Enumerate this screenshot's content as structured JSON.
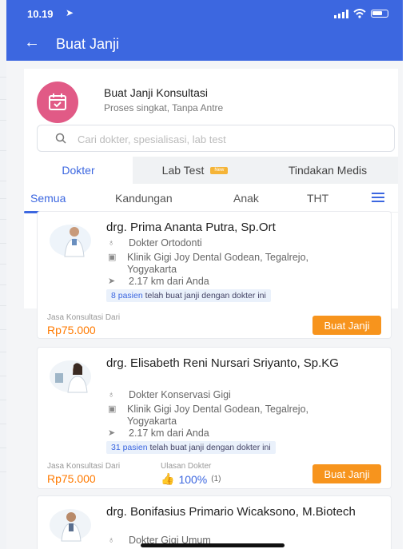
{
  "status_bar": {
    "time": "10.19"
  },
  "header": {
    "title": "Buat Janji"
  },
  "intro": {
    "title": "Buat Janji Konsultasi",
    "subtitle": "Proses singkat, Tanpa Antre"
  },
  "search": {
    "placeholder": "Cari dokter, spesialisasi, lab test"
  },
  "main_tabs": [
    {
      "label": "Dokter",
      "active": true
    },
    {
      "label": "Lab Test",
      "badge": "New"
    },
    {
      "label": "Tindakan Medis"
    }
  ],
  "sub_tabs": [
    {
      "label": "Semua",
      "active": true
    },
    {
      "label": "Kandungan"
    },
    {
      "label": "Anak"
    },
    {
      "label": "THT"
    }
  ],
  "doctors": [
    {
      "name": "drg. Prima Ananta Putra, Sp.Ort",
      "specialty": "Dokter Ortodonti",
      "clinic": "Klinik Gigi Joy Dental Godean, Tegalrejo, Yogyakarta",
      "distance": "2.17 km dari Anda",
      "patients_count": "8 pasien",
      "patients_text": "telah buat janji dengan dokter ini",
      "price_label": "Jasa Konsultasi Dari",
      "price": "Rp75.000",
      "button": "Buat Janji"
    },
    {
      "name": "drg. Elisabeth Reni Nursari Sriyanto, Sp.KG",
      "specialty": "Dokter Konservasi Gigi",
      "clinic": "Klinik Gigi Joy Dental Godean, Tegalrejo, Yogyakarta",
      "distance": "2.17 km dari Anda",
      "patients_count": "31 pasien",
      "patients_text": "telah buat janji dengan dokter ini",
      "price_label": "Jasa Konsultasi Dari",
      "price": "Rp75.000",
      "rating_label": "Ulasan Dokter",
      "rating": "100%",
      "rating_count": "(1)",
      "button": "Buat Janji"
    },
    {
      "name": "drg. Bonifasius Primario Wicaksono, M.Biotech",
      "specialty": "Dokter Gigi Umum"
    }
  ],
  "colors": {
    "primary": "#3c67e0",
    "orange": "#f7941d",
    "price": "#ff7a00",
    "pink": "#e15a86"
  }
}
